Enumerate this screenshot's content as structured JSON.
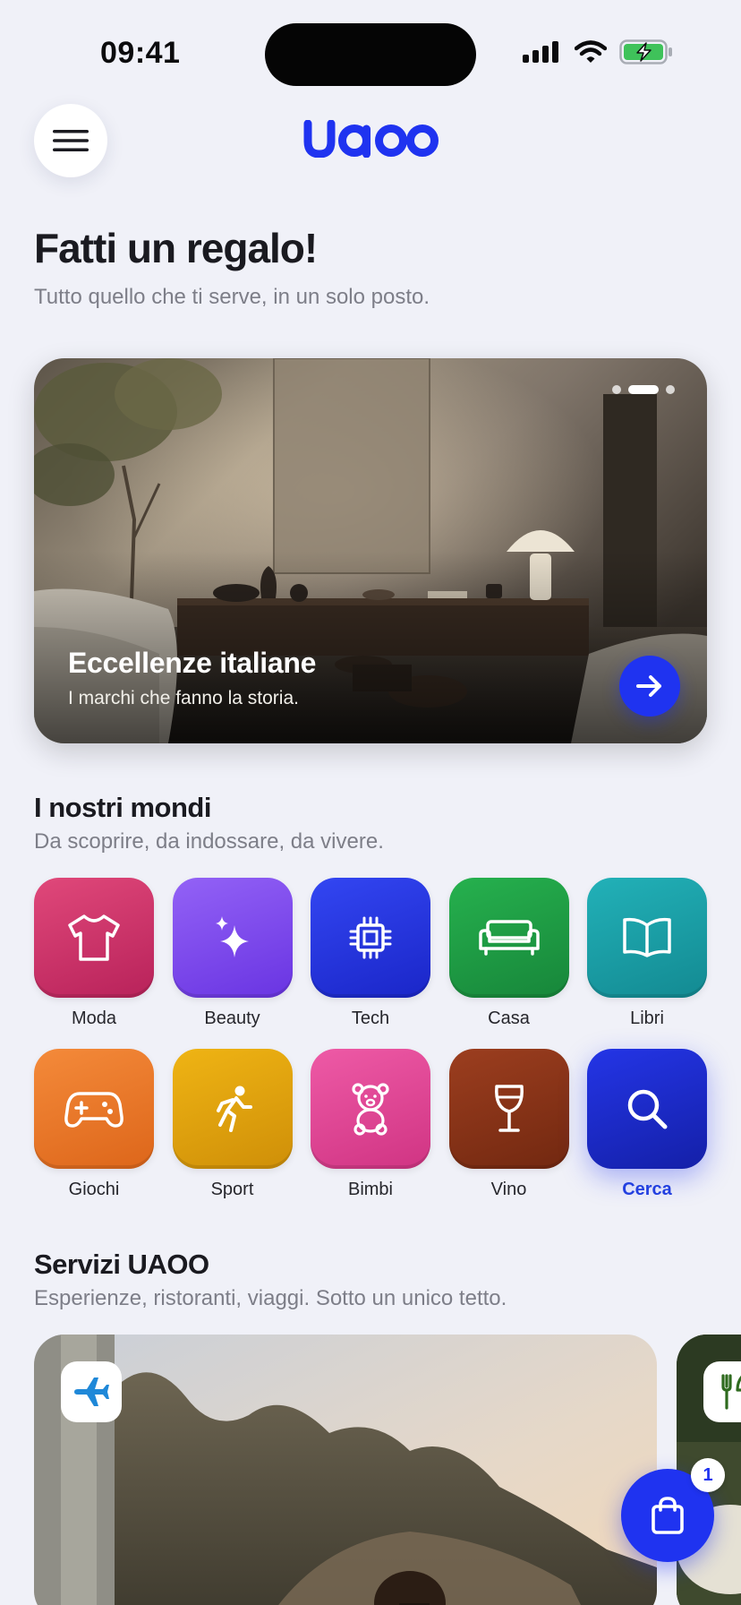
{
  "status": {
    "time": "09:41",
    "icons": [
      "signal-icon",
      "wifi-icon",
      "battery-charging-icon"
    ]
  },
  "header": {
    "logo_text": "UAOO",
    "menu_icon": "hamburger-menu-icon",
    "brand_color": "#1f33f0"
  },
  "hero": {
    "title": "Fatti un regalo!",
    "subtitle": "Tutto quello che ti serve, in un solo posto."
  },
  "banner": {
    "title": "Eccellenze italiane",
    "subtitle": "I marchi che fanno la storia.",
    "pages": 3,
    "active_page": 2,
    "arrow_icon": "arrow-right-icon"
  },
  "worlds": {
    "title": "I nostri mondi",
    "subtitle": "Da scoprire, da indossare, da vivere.",
    "items": [
      {
        "label": "Moda",
        "icon": "tshirt-icon",
        "color": "#cf2f62"
      },
      {
        "label": "Beauty",
        "icon": "sparkles-icon",
        "color": "#7e4af0"
      },
      {
        "label": "Tech",
        "icon": "chip-icon",
        "color": "#2233e6"
      },
      {
        "label": "Casa",
        "icon": "sofa-icon",
        "color": "#1f9a41"
      },
      {
        "label": "Libri",
        "icon": "book-icon",
        "color": "#1aa0a8"
      },
      {
        "label": "Giochi",
        "icon": "gamepad-icon",
        "color": "#ee7a2a"
      },
      {
        "label": "Sport",
        "icon": "runner-icon",
        "color": "#e0a20c"
      },
      {
        "label": "Bimbi",
        "icon": "teddy-bear-icon",
        "color": "#e14898"
      },
      {
        "label": "Vino",
        "icon": "wine-glass-icon",
        "color": "#8a3418"
      },
      {
        "label": "Cerca",
        "icon": "search-icon",
        "color": "#1c2bd8"
      }
    ]
  },
  "services": {
    "title": "Servizi UAOO",
    "subtitle": "Esperienze, ristoranti, viaggi. Sotto un unico tetto.",
    "cards": [
      {
        "icon": "airplane-icon"
      },
      {
        "icon": "fork-knife-icon"
      }
    ]
  },
  "cart": {
    "count": "1",
    "icon": "shopping-bag-icon"
  }
}
